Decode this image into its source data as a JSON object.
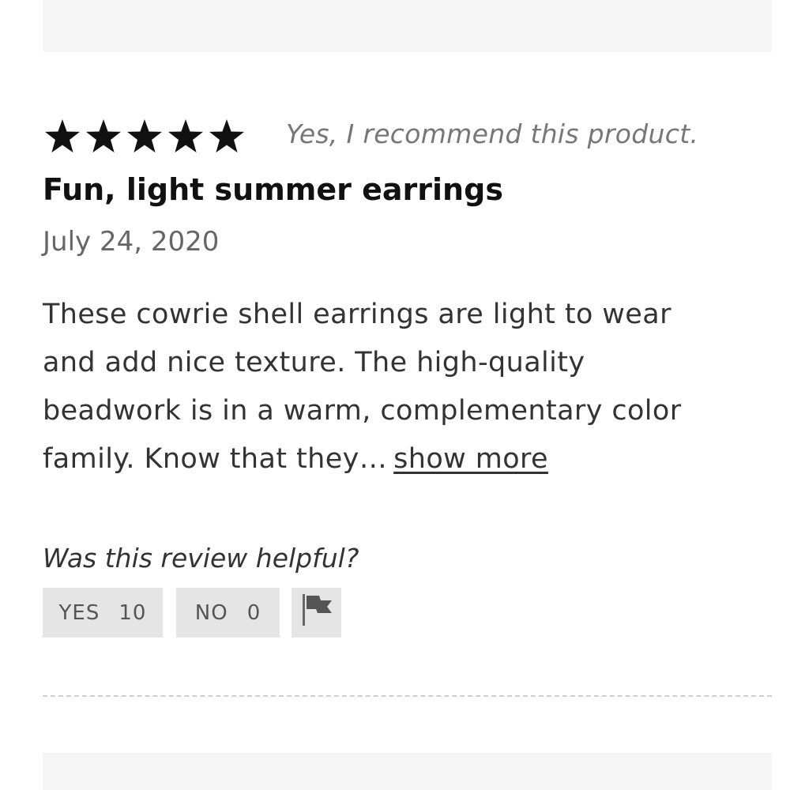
{
  "review": {
    "rating": 5,
    "rating_max": 5,
    "recommend_text": "Yes, I recommend this product.",
    "title": "Fun, light summer earrings",
    "date": "July 24, 2020",
    "body_lines": [
      "These cowrie shell earrings are light to wear",
      "and add nice texture. The high-quality",
      "beadwork is in a warm, complementary color",
      "family. Know that they…"
    ],
    "show_more_label": "show more"
  },
  "helpful": {
    "question": "Was this review helpful?",
    "yes_label": "YES",
    "yes_count": "10",
    "no_label": "NO",
    "no_count": "0",
    "flag_icon": "flag-icon"
  },
  "colors": {
    "star": "#111111",
    "button_bg": "#e5e5e5",
    "band_bg": "#f6f6f6"
  }
}
